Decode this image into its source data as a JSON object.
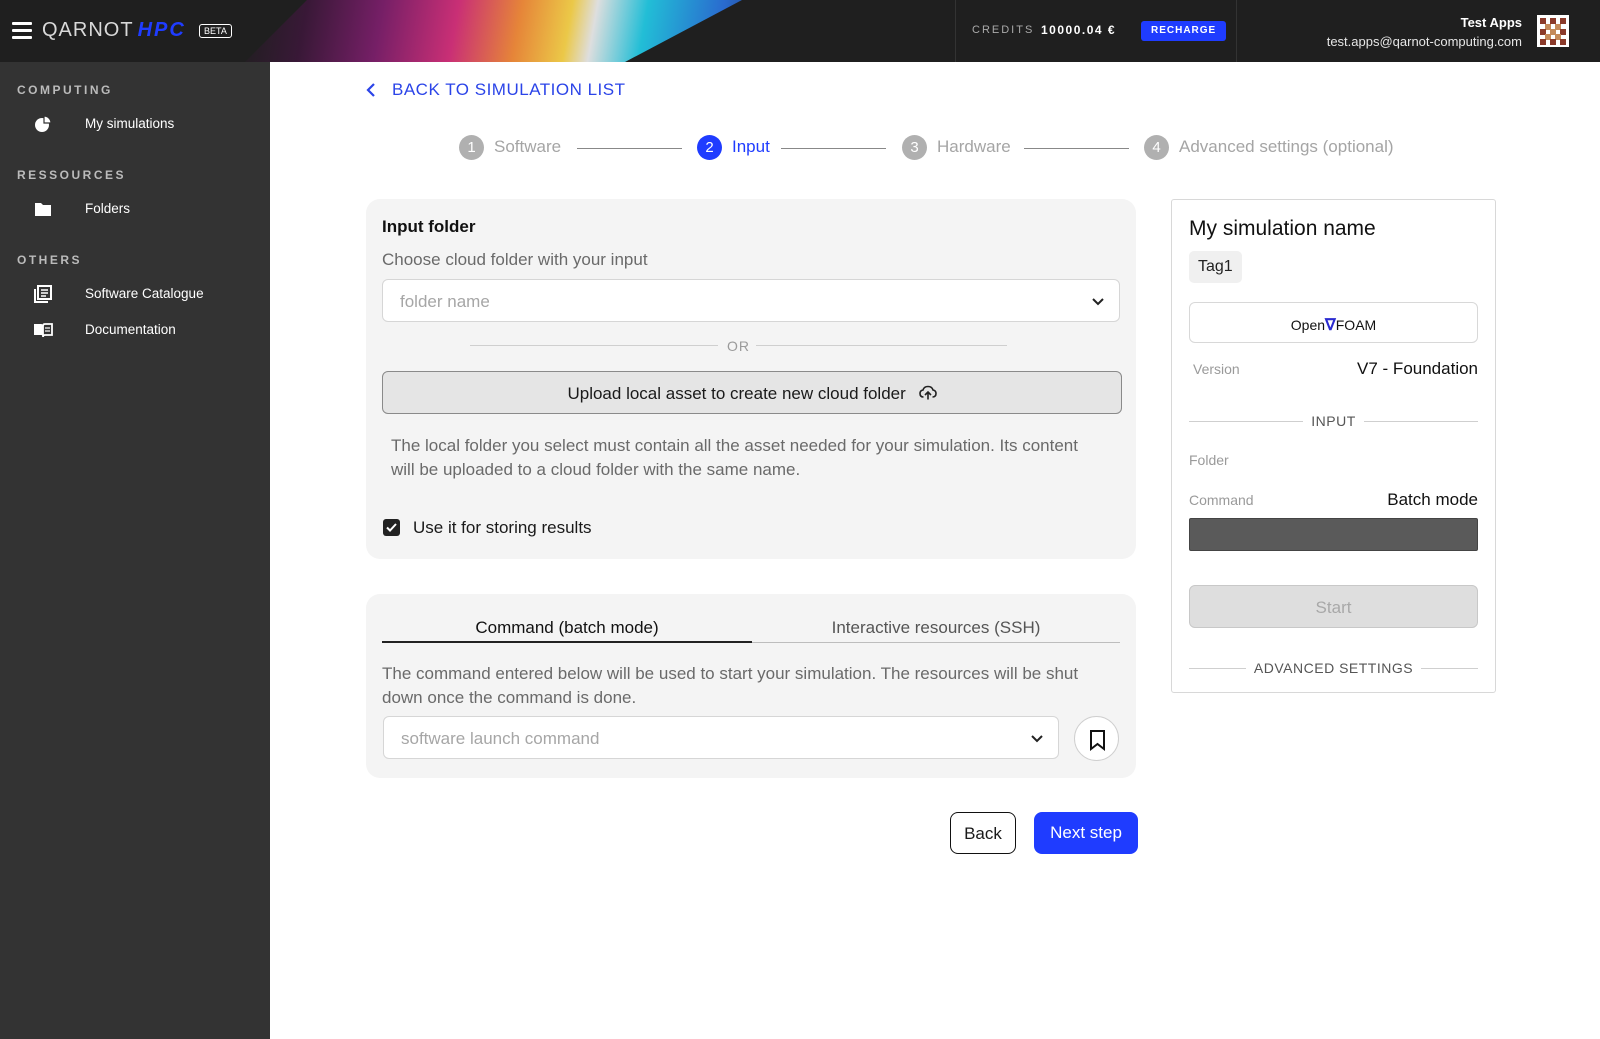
{
  "header": {
    "logo_text": "QARNOT",
    "logo_accent": "HPC",
    "beta_badge": "BETA",
    "credits_label": "CREDITS",
    "credits_value": "10000.04 €",
    "recharge_label": "RECHARGE",
    "user_name": "Test Apps",
    "user_email": "test.apps@qarnot-computing.com",
    "accent_color": "#1f3cff"
  },
  "sidebar": {
    "sections": [
      {
        "title": "COMPUTING",
        "items": [
          {
            "label": "My simulations",
            "icon": "simulations-icon"
          }
        ]
      },
      {
        "title": "RESSOURCES",
        "items": [
          {
            "label": "Folders",
            "icon": "folder-icon"
          }
        ]
      },
      {
        "title": "OTHERS",
        "items": [
          {
            "label": "Software Catalogue",
            "icon": "catalogue-icon"
          },
          {
            "label": "Documentation",
            "icon": "book-icon"
          }
        ]
      }
    ]
  },
  "main": {
    "back_link": "BACK TO SIMULATION LIST",
    "steps": [
      {
        "number": "1",
        "label": "Software",
        "active": false
      },
      {
        "number": "2",
        "label": "Input",
        "active": true
      },
      {
        "number": "3",
        "label": "Hardware",
        "active": false
      },
      {
        "number": "4",
        "label": "Advanced settings (optional)",
        "active": false
      }
    ],
    "input_folder": {
      "title": "Input folder",
      "subtitle": "Choose cloud folder with your input",
      "folder_placeholder": "folder name",
      "or_label": "OR",
      "upload_label": "Upload local asset to create new cloud folder",
      "help_text": "The local folder you select must contain all the asset needed for your simulation. Its content will be uploaded to a cloud folder with the same name.",
      "checkbox_label": "Use it for storing results",
      "checkbox_checked": true
    },
    "command": {
      "tabs": [
        {
          "label": "Command (batch mode)",
          "active": true
        },
        {
          "label": "Interactive resources (SSH)",
          "active": false
        }
      ],
      "description": "The command entered below will be used to start your simulation. The resources will be shut down once the command is done.",
      "command_placeholder": "software launch command"
    },
    "back_button": "Back",
    "next_button": "Next step"
  },
  "summary": {
    "simulation_name": "My simulation name",
    "tag": "Tag1",
    "software_prefix": "Open",
    "software_suffix": "FOAM",
    "version_label": "Version",
    "version_value": "V7 - Foundation",
    "input_divider": "INPUT",
    "folder_label": "Folder",
    "command_label": "Command",
    "command_value": "Batch mode",
    "start_button": "Start",
    "advanced_divider": "ADVANCED SETTINGS"
  }
}
